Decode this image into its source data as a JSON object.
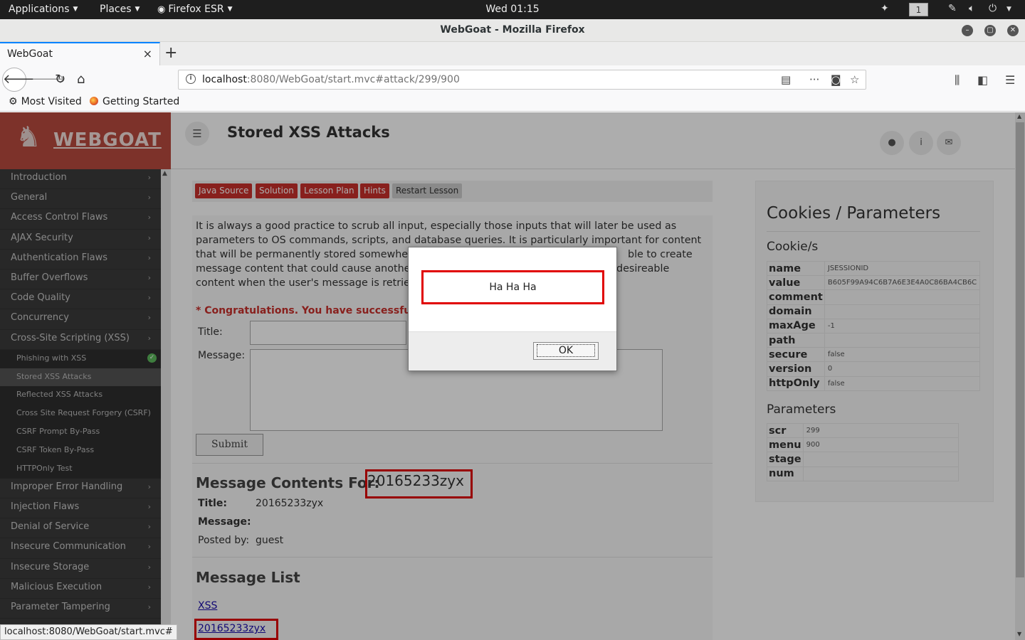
{
  "topbar": {
    "applications": "Applications",
    "places": "Places",
    "firefox": "Firefox ESR",
    "clock": "Wed 01:15",
    "workspace": "1"
  },
  "window": {
    "title": "WebGoat - Mozilla Firefox"
  },
  "tab": {
    "title": "WebGoat",
    "close": "×",
    "new": "+"
  },
  "urlbar": {
    "host": "localhost",
    "rest": ":8080/WebGoat/start.mvc#attack/299/900"
  },
  "bookmarks": {
    "most_visited": "Most Visited",
    "getting_started": "Getting Started"
  },
  "logo": {
    "text": "WEBGOAT"
  },
  "header": {
    "title": "Stored XSS Attacks"
  },
  "sidebar": {
    "categories_top": [
      "Introduction",
      "General",
      "Access Control Flaws",
      "AJAX Security",
      "Authentication Flaws",
      "Buffer Overflows",
      "Code Quality",
      "Concurrency",
      "Cross-Site Scripting (XSS)"
    ],
    "subitems": [
      "Phishing with XSS",
      "Stored XSS Attacks",
      "Reflected XSS Attacks",
      "Cross Site Request Forgery (CSRF)",
      "CSRF Prompt By-Pass",
      "CSRF Token By-Pass",
      "HTTPOnly Test"
    ],
    "categories_bottom": [
      "Improper Error Handling",
      "Injection Flaws",
      "Denial of Service",
      "Insecure Communication",
      "Insecure Storage",
      "Malicious Execution",
      "Parameter Tampering"
    ],
    "chevron": "›"
  },
  "lesson_buttons": [
    "Java Source",
    "Solution",
    "Lesson Plan",
    "Hints",
    "Restart Lesson"
  ],
  "lesson": {
    "intro_1": "It is always a good practice to scrub all input, especially those inputs that will later be used as",
    "intro_2": "parameters to OS commands, scripts, and database queries. It is particularly important for content",
    "intro_3a": "that will be permanently stored somewher",
    "intro_3b": "ble to create",
    "intro_4a": "message content that could cause anothe",
    "intro_4b": "desireable",
    "intro_5": "content when the user's message is retriev",
    "congrats": "* Congratulations. You have successfu",
    "title_label": "Title:",
    "message_label": "Message:",
    "submit": "Submit",
    "msg_contents_label": "Message Contents For:",
    "msg_contents_name": "20165233zyx",
    "detail_title_label": "Title:",
    "detail_title_value": "20165233zyx",
    "detail_message_label": "Message:",
    "posted_by_label": "Posted by:",
    "posted_by_value": "guest",
    "message_list_heading": "Message List",
    "list_items": [
      "XSS",
      "20165233zyx"
    ]
  },
  "cookies_panel": {
    "title": "Cookies / Parameters",
    "cookies_heading": "Cookie/s",
    "cookies": [
      {
        "k": "name",
        "v": "JSESSIONID"
      },
      {
        "k": "value",
        "v": "B605F99A94C6B7A6E3E4A0C86BA4CB6C"
      },
      {
        "k": "comment",
        "v": ""
      },
      {
        "k": "domain",
        "v": ""
      },
      {
        "k": "maxAge",
        "v": "-1"
      },
      {
        "k": "path",
        "v": ""
      },
      {
        "k": "secure",
        "v": "false"
      },
      {
        "k": "version",
        "v": "0"
      },
      {
        "k": "httpOnly",
        "v": "false"
      }
    ],
    "params_heading": "Parameters",
    "params": [
      {
        "k": "scr",
        "v": "299"
      },
      {
        "k": "menu",
        "v": "900"
      },
      {
        "k": "stage",
        "v": ""
      },
      {
        "k": "num",
        "v": ""
      }
    ]
  },
  "dialog": {
    "message": "Ha Ha Ha",
    "ok": "OK"
  },
  "statusbar": {
    "text": "localhost:8080/WebGoat/start.mvc#"
  },
  "colors": {
    "accent_red": "#c9302c",
    "highlight_box": "#e00000",
    "sidebar_bg": "#3b3b3b",
    "logo_bg": "#b84a3e"
  }
}
